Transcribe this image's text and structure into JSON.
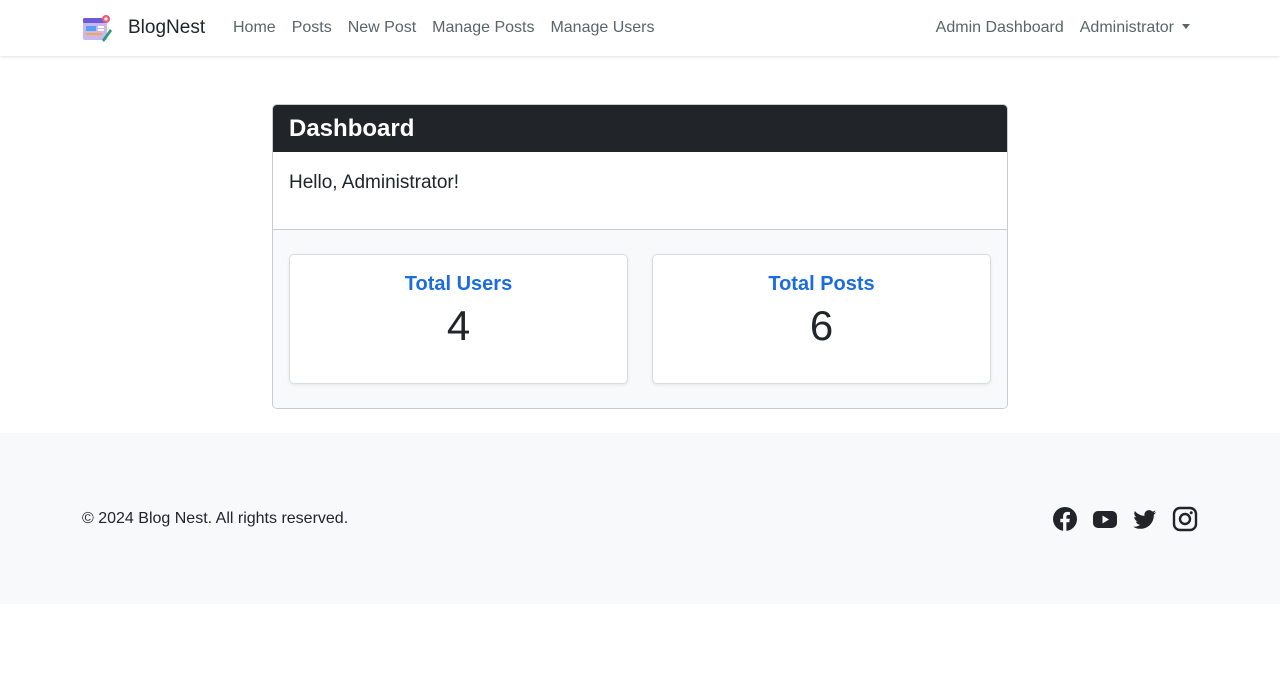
{
  "navbar": {
    "brand": "BlogNest",
    "links": [
      {
        "label": "Home"
      },
      {
        "label": "Posts"
      },
      {
        "label": "New Post"
      },
      {
        "label": "Manage Posts"
      },
      {
        "label": "Manage Users"
      }
    ],
    "admin_dashboard": "Admin Dashboard",
    "user_menu": "Administrator"
  },
  "dashboard": {
    "title": "Dashboard",
    "greeting": "Hello, Administrator!",
    "stats": {
      "users": {
        "label": "Total Users",
        "value": "4"
      },
      "posts": {
        "label": "Total Posts",
        "value": "6"
      }
    }
  },
  "footer": {
    "copyright": "© 2024 Blog Nest. All rights reserved.",
    "social_icons": [
      "facebook-icon",
      "youtube-icon",
      "twitter-icon",
      "instagram-icon"
    ]
  },
  "colors": {
    "card_header_bg": "#212529",
    "stat_label": "#1a6ce0",
    "footer_bg": "#f8f9fa",
    "nav_link": "#5c636a"
  }
}
